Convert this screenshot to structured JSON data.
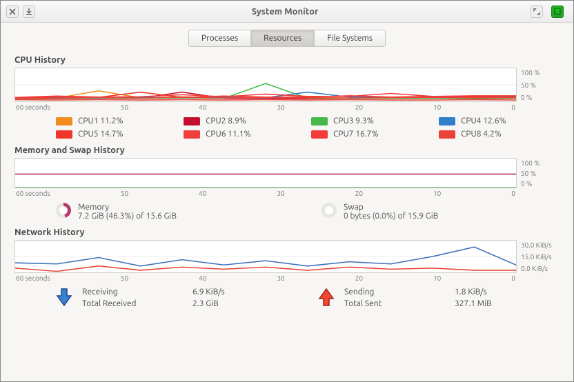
{
  "title": "System Monitor",
  "tabs": {
    "processes": "Processes",
    "resources": "Resources",
    "filesystems": "File Systems"
  },
  "sections": {
    "cpu": "CPU History",
    "mem": "Memory and Swap History",
    "net": "Network History"
  },
  "xaxis": {
    "start": "60 seconds",
    "t50": "50",
    "t40": "40",
    "t30": "30",
    "t20": "20",
    "t10": "10",
    "end": "0"
  },
  "yaxis_pct": {
    "top": "100 %",
    "mid": "50 %",
    "bot": "0 %"
  },
  "cpu_legend": [
    {
      "label": "CPU1  11.2%",
      "color": "#f08c1e"
    },
    {
      "label": "CPU2  8.9%",
      "color": "#c40f2c"
    },
    {
      "label": "CPU3  9.3%",
      "color": "#46b84a"
    },
    {
      "label": "CPU4  12.6%",
      "color": "#2f7fc8"
    },
    {
      "label": "CPU5  14.7%",
      "color": "#f0362a"
    },
    {
      "label": "CPU6  11.1%",
      "color": "#ef3f3a"
    },
    {
      "label": "CPU7  16.7%",
      "color": "#f23c38"
    },
    {
      "label": "CPU8  4.2%",
      "color": "#eb4137"
    }
  ],
  "memory": {
    "mem_label": "Memory",
    "mem_value": "7.2 GiB (46.3%) of 15.6 GiB",
    "mem_pct": 46.3,
    "mem_color": "#b43a6a",
    "swap_label": "Swap",
    "swap_value": "0 bytes (0.0%) of 15.9 GiB",
    "swap_pct": 0,
    "swap_color": "#3cb049"
  },
  "network": {
    "ylabels": {
      "top": "30.0 KiB/s",
      "mid": "15.0 KiB/s",
      "bot": "0.0 KiB/s"
    },
    "recv_label": "Receiving",
    "recv_rate": "6.9 KiB/s",
    "recv_total_label": "Total Received",
    "recv_total": "2.3 GiB",
    "send_label": "Sending",
    "send_rate": "1.8 KiB/s",
    "send_total_label": "Total Sent",
    "send_total": "327.1 MiB",
    "recv_color": "#3b6fb8",
    "send_color": "#e8432f"
  },
  "chart_data": [
    {
      "type": "line",
      "title": "CPU History",
      "xlabel": "seconds ago",
      "ylabel": "%",
      "ylim": [
        0,
        100
      ],
      "x": [
        60,
        55,
        50,
        45,
        40,
        35,
        30,
        25,
        20,
        15,
        10,
        5,
        0
      ],
      "series": [
        {
          "name": "CPU1",
          "color": "#f08c1e",
          "values": [
            9,
            10,
            32,
            11,
            14,
            10,
            11,
            12,
            10,
            10,
            12,
            12,
            11
          ]
        },
        {
          "name": "CPU2",
          "color": "#c40f2c",
          "values": [
            8,
            8,
            9,
            10,
            28,
            9,
            9,
            8,
            9,
            10,
            9,
            8,
            9
          ]
        },
        {
          "name": "CPU3",
          "color": "#46b84a",
          "values": [
            8,
            9,
            9,
            9,
            10,
            9,
            54,
            10,
            9,
            9,
            9,
            9,
            9
          ]
        },
        {
          "name": "CPU4",
          "color": "#2f7fc8",
          "values": [
            10,
            11,
            10,
            12,
            11,
            12,
            11,
            28,
            13,
            12,
            12,
            13,
            13
          ]
        },
        {
          "name": "CPU5",
          "color": "#f0362a",
          "values": [
            10,
            14,
            12,
            28,
            12,
            16,
            13,
            13,
            17,
            13,
            15,
            14,
            15
          ]
        },
        {
          "name": "CPU6",
          "color": "#ef3f3a",
          "values": [
            9,
            10,
            11,
            10,
            12,
            10,
            12,
            11,
            10,
            11,
            12,
            11,
            11
          ]
        },
        {
          "name": "CPU7",
          "color": "#f23c38",
          "values": [
            12,
            16,
            13,
            14,
            20,
            14,
            22,
            15,
            15,
            24,
            15,
            17,
            17
          ]
        },
        {
          "name": "CPU8",
          "color": "#eb4137",
          "values": [
            5,
            4,
            5,
            4,
            5,
            4,
            5,
            4,
            5,
            4,
            4,
            5,
            4
          ]
        }
      ]
    },
    {
      "type": "line",
      "title": "Memory and Swap History",
      "xlabel": "seconds ago",
      "ylabel": "%",
      "ylim": [
        0,
        100
      ],
      "x": [
        60,
        0
      ],
      "series": [
        {
          "name": "Memory",
          "color": "#b43a6a",
          "values": [
            46.3,
            46.3
          ]
        },
        {
          "name": "Swap",
          "color": "#3cb049",
          "values": [
            0,
            0
          ]
        }
      ]
    },
    {
      "type": "line",
      "title": "Network History",
      "xlabel": "seconds ago",
      "ylabel": "KiB/s",
      "ylim": [
        0,
        30
      ],
      "x": [
        60,
        55,
        50,
        45,
        40,
        35,
        30,
        25,
        20,
        15,
        10,
        5,
        0
      ],
      "series": [
        {
          "name": "Receiving",
          "color": "#3b6fb8",
          "values": [
            9,
            8,
            14,
            6,
            12,
            7,
            11,
            6,
            10,
            8,
            15,
            24,
            7
          ]
        },
        {
          "name": "Sending",
          "color": "#e8432f",
          "values": [
            4,
            1,
            6,
            2,
            5,
            3,
            5,
            2,
            5,
            3,
            4,
            2,
            2
          ]
        }
      ]
    }
  ]
}
